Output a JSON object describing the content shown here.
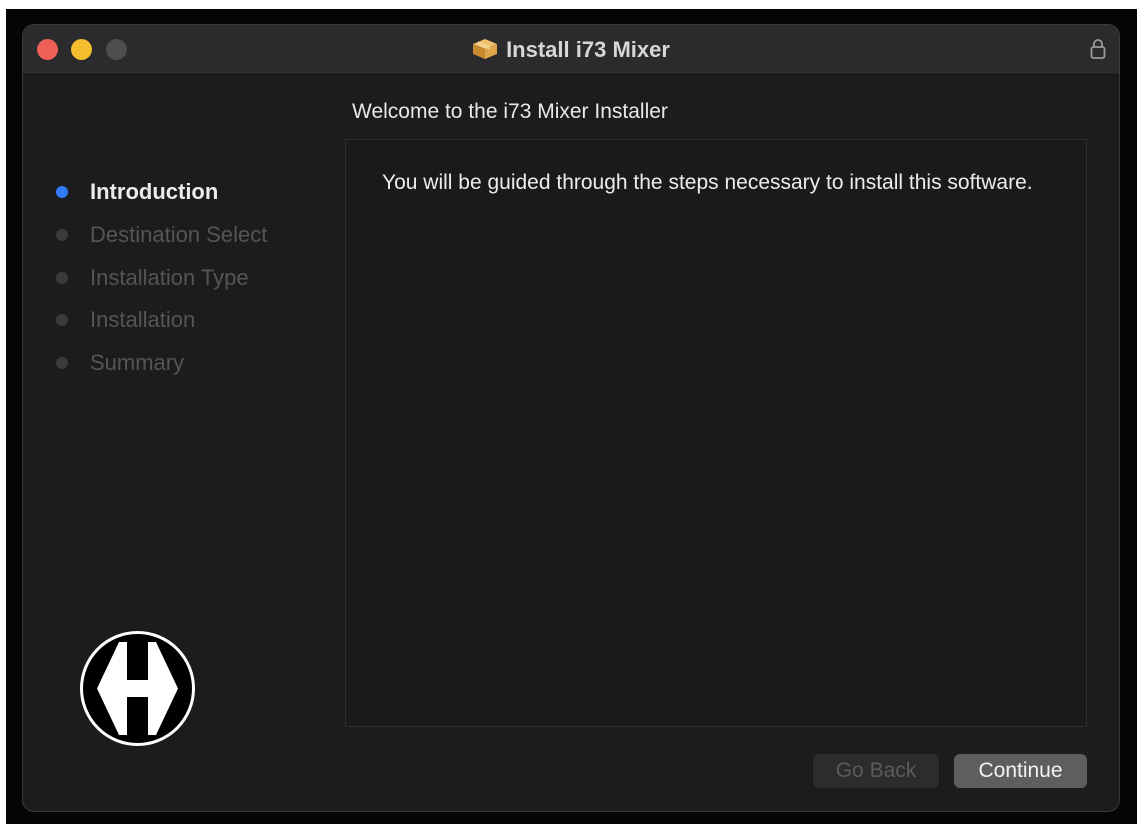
{
  "window": {
    "title": "Install i73 Mixer",
    "icon": "package-icon",
    "lock_icon": "lock-icon"
  },
  "sidebar": {
    "steps": [
      {
        "label": "Introduction",
        "active": true
      },
      {
        "label": "Destination Select",
        "active": false
      },
      {
        "label": "Installation Type",
        "active": false
      },
      {
        "label": "Installation",
        "active": false
      },
      {
        "label": "Summary",
        "active": false
      }
    ],
    "active_color": "#2f7cf6",
    "logo": "harrison-logo"
  },
  "main": {
    "heading": "Welcome to the i73 Mixer  Installer",
    "body_text": "You will be guided through the steps necessary to install this software."
  },
  "buttons": {
    "back_label": "Go Back",
    "back_enabled": false,
    "continue_label": "Continue"
  },
  "colors": {
    "close": "#ee5f57",
    "minimize": "#f5be2f",
    "zoom_disabled": "#4e4e51"
  }
}
